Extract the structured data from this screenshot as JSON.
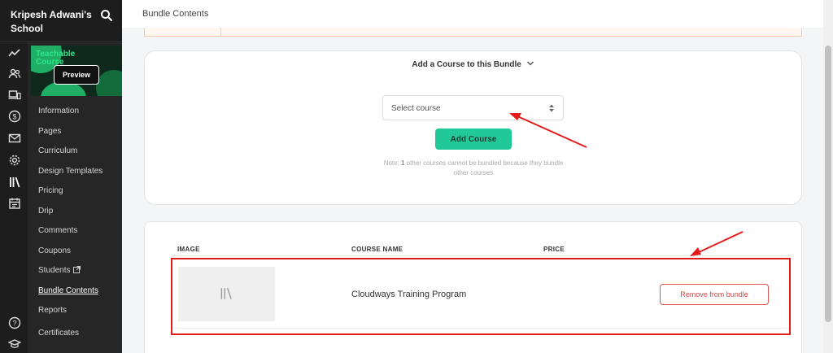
{
  "school": {
    "name": "Kripesh Adwani's School"
  },
  "course_thumb": {
    "title": "Teachable Course",
    "preview_label": "Preview"
  },
  "nav": {
    "information": "Information",
    "pages": "Pages",
    "curriculum": "Curriculum",
    "design_templates": "Design Templates",
    "pricing": "Pricing",
    "drip": "Drip",
    "comments": "Comments",
    "coupons": "Coupons",
    "students": "Students",
    "bundle_contents": "Bundle Contents",
    "reports": "Reports",
    "certificates": "Certificates"
  },
  "rail_icons": [
    "trend-icon",
    "users-icon",
    "devices-icon",
    "dollar-icon",
    "mail-icon",
    "gear-icon",
    "library-icon",
    "calendar-icon",
    "help-icon",
    "graduation-cap-icon"
  ],
  "header": {
    "title": "Bundle Contents"
  },
  "add_course": {
    "heading": "Add a Course to this Bundle",
    "select_value": "Select course",
    "button_label": "Add Course",
    "note_prefix": "Note: ",
    "note_count": "1",
    "note_rest": " other courses cannot be bundled because they bundle other courses"
  },
  "table": {
    "columns": {
      "image": "IMAGE",
      "course_name": "COURSE NAME",
      "price": "PRICE"
    },
    "rows": [
      {
        "course_name": "Cloudways Training Program",
        "price": "",
        "action": "Remove from bundle"
      }
    ]
  },
  "colors": {
    "accent_green": "#20c997",
    "annotation_red": "#e21b1b",
    "sidebar_bg": "#1d1d1d"
  }
}
